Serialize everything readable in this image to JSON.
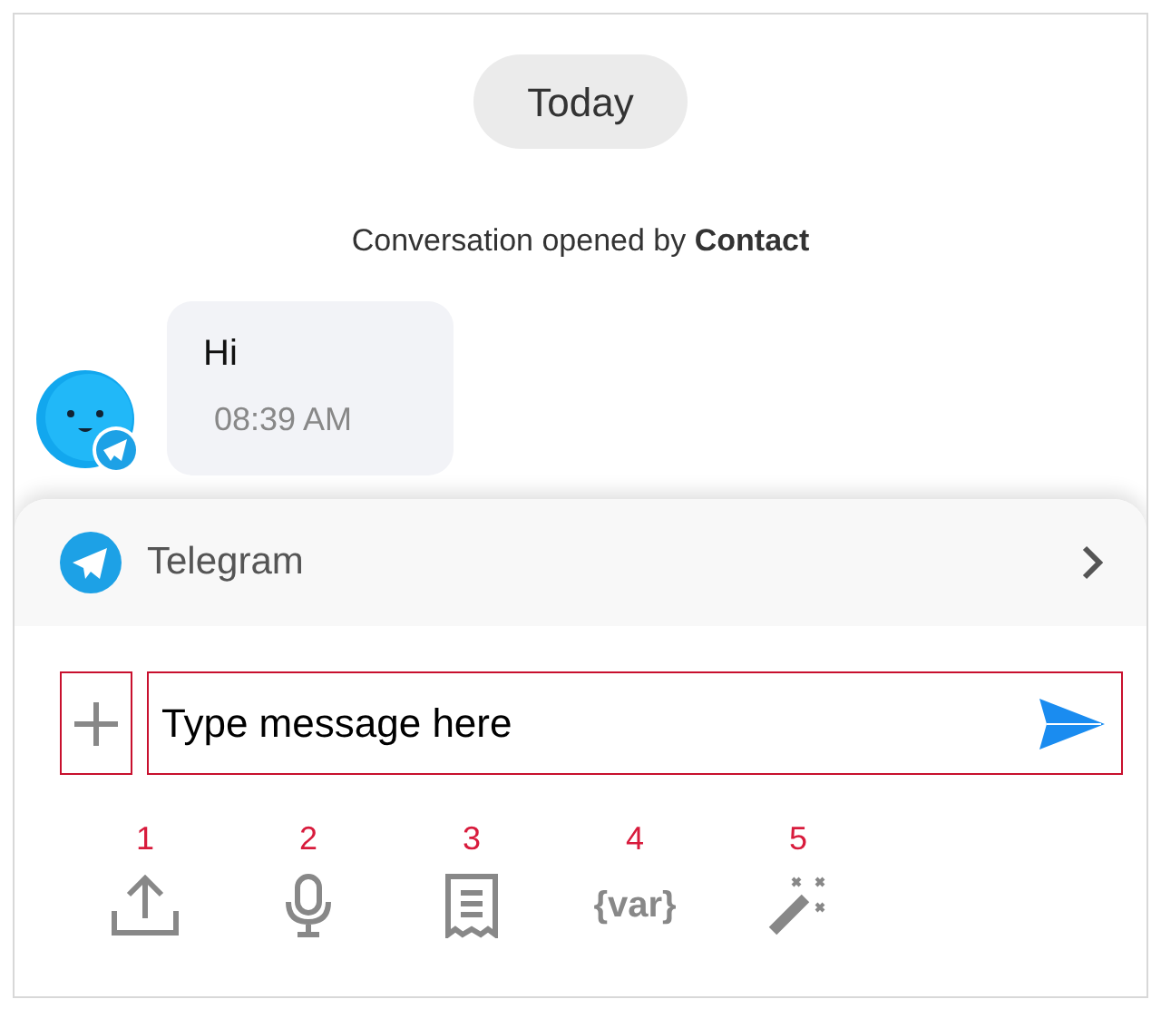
{
  "date_divider": "Today",
  "system_message": "Conversation opened by **Contact**",
  "messages": [
    {
      "text": "Hi",
      "time": "08:39 AM"
    }
  ],
  "channel": {
    "name": "Telegram"
  },
  "composer": {
    "placeholder": "Type message here"
  },
  "tools": [
    {
      "number": "1",
      "kind": "upload"
    },
    {
      "number": "2",
      "kind": "mic"
    },
    {
      "number": "3",
      "kind": "template"
    },
    {
      "number": "4",
      "kind": "variable",
      "label": "{var}"
    },
    {
      "number": "5",
      "kind": "magic"
    }
  ]
}
